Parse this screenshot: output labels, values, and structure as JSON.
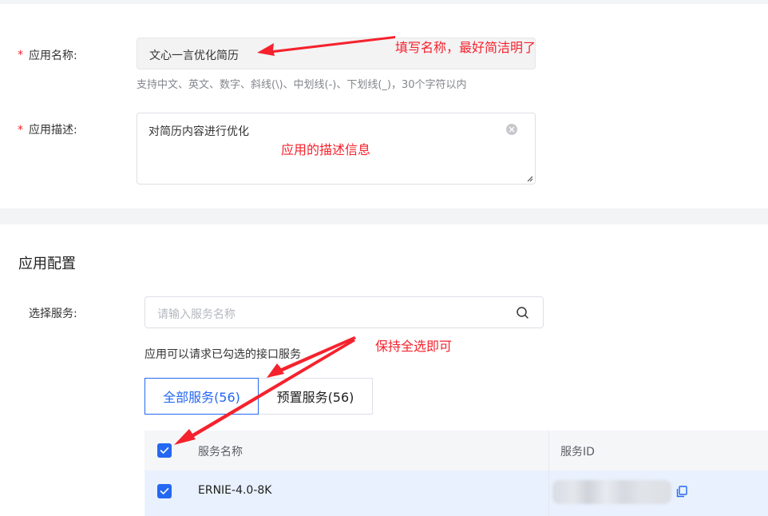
{
  "form": {
    "required_mark": "*",
    "name_label": "应用名称:",
    "name_value": "文心一言优化简历",
    "name_hint": "支持中文、英文、数字、斜线(\\)、中划线(-)、下划线(_)，30个字符以内",
    "desc_label": "应用描述:",
    "desc_value": "对简历内容进行优化"
  },
  "config": {
    "section_title": "应用配置",
    "service_label": "选择服务:",
    "search_placeholder": "请输入服务名称",
    "service_note": "应用可以请求已勾选的接口服务",
    "tabs": [
      {
        "label": "全部服务(56)",
        "active": true
      },
      {
        "label": "预置服务(56)",
        "active": false
      }
    ]
  },
  "table": {
    "columns": [
      "服务名称",
      "服务ID"
    ],
    "rows": [
      {
        "name": "ERNIE-4.0-8K",
        "checked": true
      }
    ],
    "header_checked": true
  },
  "annotations": {
    "name_tip": "填写名称，最好简洁明了",
    "desc_tip": "应用的描述信息",
    "select_tip": "保持全选即可"
  },
  "colors": {
    "accent": "#2468f2",
    "annotation": "#f5222d",
    "selected_row": "#e9f1fe"
  }
}
